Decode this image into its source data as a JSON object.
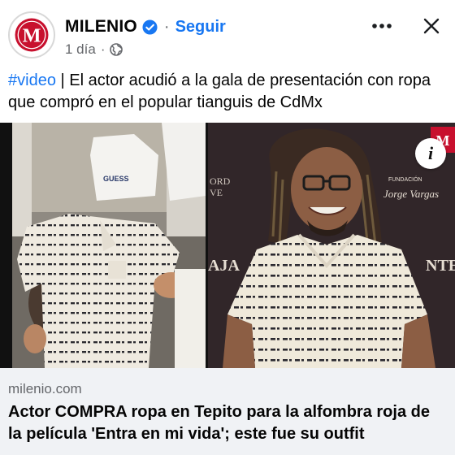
{
  "header": {
    "page_name": "MILENIO",
    "separator": "·",
    "follow_label": "Seguir",
    "time": "1 día",
    "time_separator": "·",
    "avatar_letter": "M",
    "icons": {
      "avatar": "milenio-logo",
      "verified": "verified-badge-icon",
      "privacy": "globe-icon",
      "more": "more-options-icon",
      "close": "close-icon"
    }
  },
  "caption": {
    "hashtag": "#video",
    "text": " | El actor acudió a la gala de presentación con ropa que compró en el popular tianguis de CdMx"
  },
  "media": {
    "left_photo_shirt_label": "GUESS",
    "backdrop_text_left": "ORD",
    "backdrop_text_left_2": "VE",
    "backdrop_text_center": "AJA",
    "backdrop_text_right": "NTEI",
    "backdrop_fundacion": "FUNDACIÓN",
    "backdrop_signature": "Jorge Vargas",
    "overlay_logo_letter": "M",
    "info_label": "i"
  },
  "link_preview": {
    "domain": "milenio.com",
    "title": "Actor COMPRA ropa en Tepito para la alfombra roja de la película 'Entra en mi vida'; este fue su outfit"
  },
  "colors": {
    "brand_red": "#c8102e",
    "link_blue": "#1877f2",
    "secondary_text": "#65676b",
    "preview_bg": "#f0f2f5"
  }
}
